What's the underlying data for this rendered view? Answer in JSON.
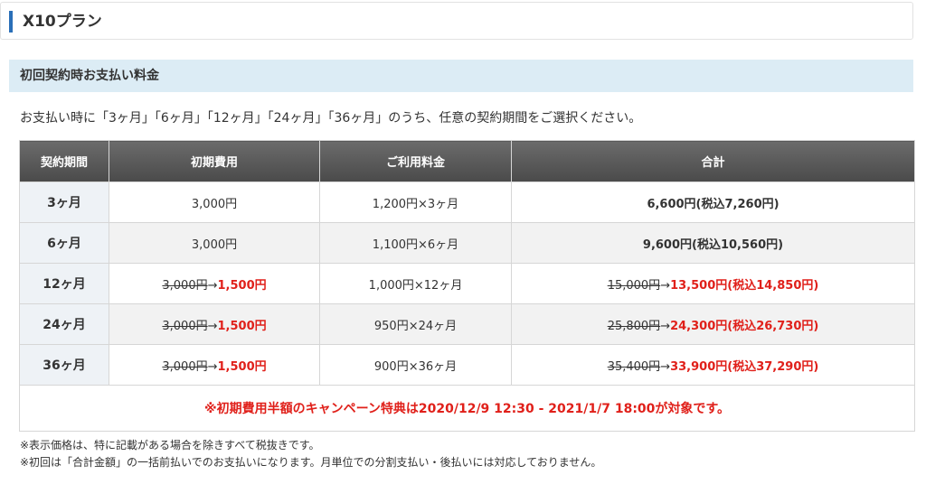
{
  "plan": {
    "title": "X10プラン"
  },
  "section": {
    "title": "初回契約時お支払い料金"
  },
  "intro": "お支払い時に「3ヶ月」「6ヶ月」「12ヶ月」「24ヶ月」「36ヶ月」のうち、任意の契約期間をご選択ください。",
  "table": {
    "headers": [
      "契約期間",
      "初期費用",
      "ご利用料金",
      "合計"
    ],
    "rows": [
      {
        "period": "3ヶ月",
        "initial": "3,000円",
        "usage": "1,200円×3ヶ月",
        "total": "6,600円(税込7,260円)"
      },
      {
        "period": "6ヶ月",
        "initial": "3,000円",
        "usage": "1,100円×6ヶ月",
        "total": "9,600円(税込10,560円)"
      },
      {
        "period": "12ヶ月",
        "initial_old": "3,000円",
        "initial_new": "1,500円",
        "usage": "1,000円×12ヶ月",
        "total_old": "15,000円",
        "total_new": "13,500円(税込14,850円)"
      },
      {
        "period": "24ヶ月",
        "initial_old": "3,000円",
        "initial_new": "1,500円",
        "usage": "950円×24ヶ月",
        "total_old": "25,800円",
        "total_new": "24,300円(税込26,730円)"
      },
      {
        "period": "36ヶ月",
        "initial_old": "3,000円",
        "initial_new": "1,500円",
        "usage": "900円×36ヶ月",
        "total_old": "35,400円",
        "total_new": "33,900円(税込37,290円)"
      }
    ],
    "arrow": "→",
    "campaign": "※初期費用半額のキャンペーン特典は2020/12/9 12:30 - 2021/1/7 18:00が対象です。"
  },
  "notes": [
    "※表示価格は、特に記載がある場合を除きすべて税抜きです。",
    "※初回は「合計金額」の一括前払いでのお支払いになります。月単位での分割支払い・後払いには対応しておりません。"
  ],
  "colors": {
    "accent_bar": "#2a6fb8",
    "section_bg": "#dcecf5",
    "header_bg": "#5a5a5a",
    "discount_red": "#e0201a"
  }
}
